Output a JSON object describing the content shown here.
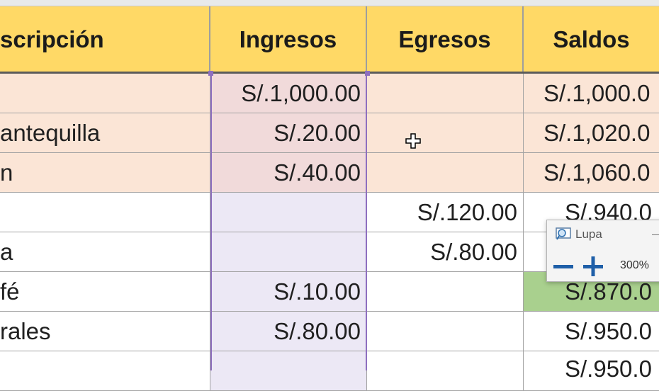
{
  "headers": [
    "scripción",
    "Ingresos",
    "Egresos",
    "Saldos"
  ],
  "rows": [
    {
      "desc": "",
      "ingresos": "S/.1,000.00",
      "egresos": "",
      "saldos": "S/.1,000.0"
    },
    {
      "desc": "antequilla",
      "ingresos": "S/.20.00",
      "egresos": "",
      "saldos": "S/.1,020.0"
    },
    {
      "desc": "n",
      "ingresos": "S/.40.00",
      "egresos": "",
      "saldos": "S/.1,060.0"
    },
    {
      "desc": "",
      "ingresos": "",
      "egresos": "S/.120.00",
      "saldos": "S/.940.0"
    },
    {
      "desc": "a",
      "ingresos": "",
      "egresos": "S/.80.00",
      "saldos": ""
    },
    {
      "desc": "fé",
      "ingresos": "S/.10.00",
      "egresos": "",
      "saldos": "S/.870.0"
    },
    {
      "desc": "rales",
      "ingresos": "S/.80.00",
      "egresos": "",
      "saldos": "S/.950.0"
    },
    {
      "desc": "",
      "ingresos": "",
      "egresos": "",
      "saldos": "S/.950.0"
    }
  ],
  "magnifier": {
    "title": "Lupa",
    "zoom": "300%"
  },
  "colors": {
    "header": "#ffd966",
    "highlight_row": "#fbe5d6",
    "highlight_selected": "#f1dada",
    "selection_column": "#ece8f5",
    "selection_border": "#8e6fbf",
    "saldo_green": "#a9d08e"
  }
}
